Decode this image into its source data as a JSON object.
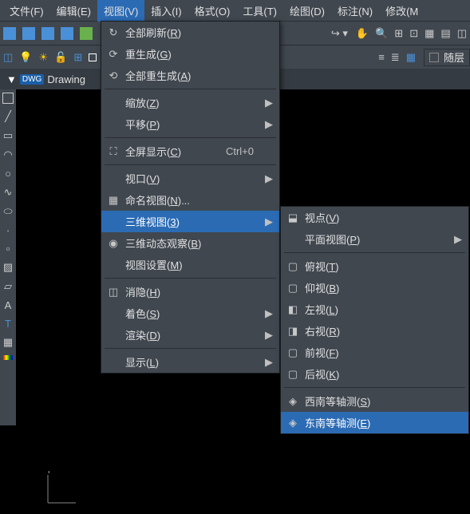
{
  "menubar": {
    "items": [
      {
        "label": "文件(F)"
      },
      {
        "label": "编辑(E)"
      },
      {
        "label": "视图(V)",
        "active": true
      },
      {
        "label": "插入(I)"
      },
      {
        "label": "格式(O)"
      },
      {
        "label": "工具(T)"
      },
      {
        "label": "绘图(D)"
      },
      {
        "label": "标注(N)"
      },
      {
        "label": "修改(M"
      }
    ]
  },
  "tab": {
    "name": "Drawing"
  },
  "layer": {
    "name": "随层"
  },
  "menu1": {
    "items": [
      {
        "icon": "↻",
        "label": "全部刷新(R)"
      },
      {
        "icon": "⟳",
        "label": "重生成(G)"
      },
      {
        "icon": "⟲",
        "label": "全部重生成(A)"
      },
      {
        "sep": true
      },
      {
        "label": "缩放(Z)",
        "sub": true
      },
      {
        "label": "平移(P)",
        "sub": true
      },
      {
        "sep": true
      },
      {
        "icon": "⛶",
        "label": "全屏显示(C)",
        "accel": "Ctrl+0"
      },
      {
        "sep": true
      },
      {
        "label": "视口(V)",
        "sub": true
      },
      {
        "icon": "▦",
        "label": "命名视图(N)..."
      },
      {
        "label": "三维视图(3)",
        "sub": true,
        "hl": true
      },
      {
        "icon": "◉",
        "label": "三维动态观察(B)"
      },
      {
        "label": "视图设置(M)"
      },
      {
        "sep": true
      },
      {
        "icon": "◫",
        "label": "消隐(H)"
      },
      {
        "label": "着色(S)",
        "sub": true
      },
      {
        "label": "渲染(D)",
        "sub": true
      },
      {
        "sep": true
      },
      {
        "label": "显示(L)",
        "sub": true
      }
    ]
  },
  "menu2": {
    "items": [
      {
        "icon": "⬓",
        "label": "视点(V)"
      },
      {
        "label": "平面视图(P)",
        "sub": true
      },
      {
        "sep": true
      },
      {
        "icon": "▢",
        "label": "俯视(T)"
      },
      {
        "icon": "▢",
        "label": "仰视(B)"
      },
      {
        "icon": "◧",
        "label": "左视(L)"
      },
      {
        "icon": "◨",
        "label": "右视(R)"
      },
      {
        "icon": "▢",
        "label": "前视(F)"
      },
      {
        "icon": "▢",
        "label": "后视(K)"
      },
      {
        "sep": true
      },
      {
        "icon": "◈",
        "label": "西南等轴测(S)"
      },
      {
        "icon": "◈",
        "label": "东南等轴测(E)",
        "hl": true
      }
    ]
  }
}
